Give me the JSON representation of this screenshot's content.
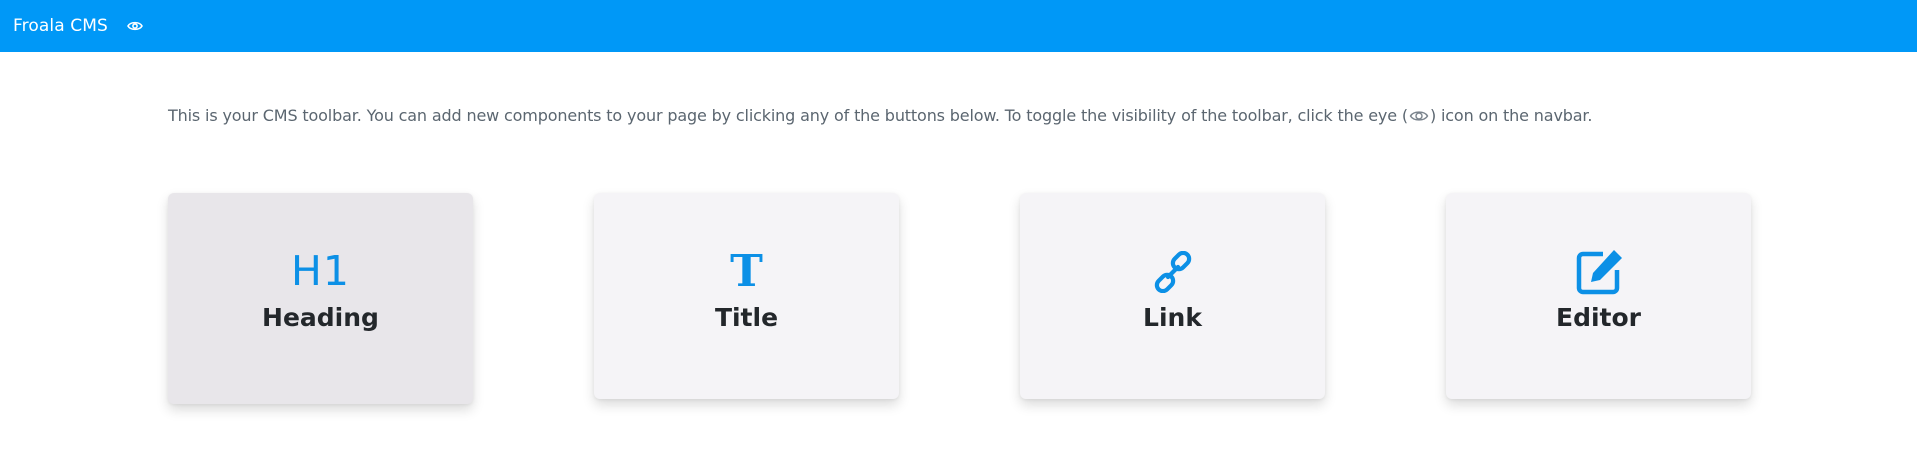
{
  "navbar": {
    "brand": "Froala CMS",
    "eye_icon": "eye-icon",
    "background_color": "#0098f7"
  },
  "intro": {
    "text_before": "This is your CMS toolbar. You can add new components to your page by clicking any of the buttons below. To toggle the visibility of the toolbar, click the eye (",
    "text_after": ") icon on the navbar."
  },
  "toolbar": {
    "accent_color": "#0c90e6",
    "buttons": [
      {
        "label": "Heading",
        "icon": "h1-icon",
        "glyph": "H1",
        "active": true
      },
      {
        "label": "Title",
        "icon": "title-t-icon",
        "glyph": "T",
        "active": false
      },
      {
        "label": "Link",
        "icon": "link-icon",
        "active": false
      },
      {
        "label": "Editor",
        "icon": "edit-icon",
        "active": false
      }
    ]
  }
}
